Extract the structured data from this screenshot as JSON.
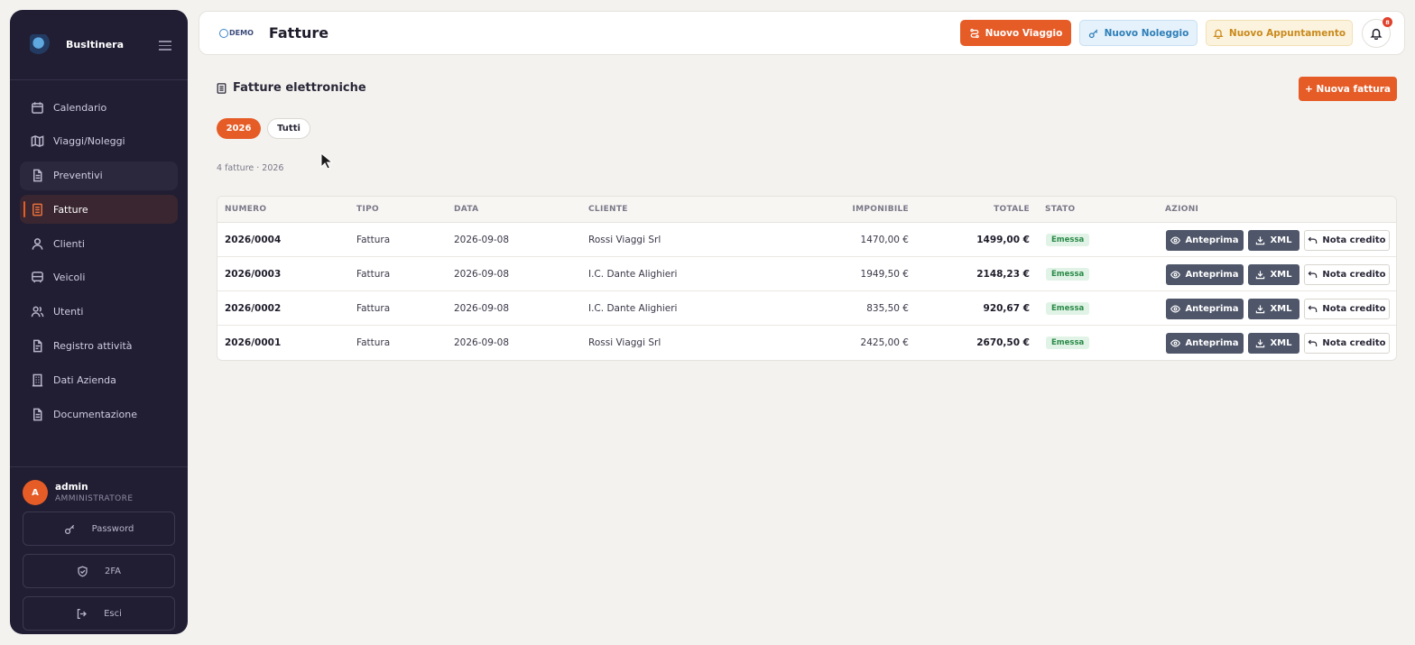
{
  "app": {
    "brand_name": "BusItinera",
    "page_title": "Fatture",
    "demo_label": "DEMO"
  },
  "sidebar": {
    "items": [
      {
        "label": "Calendario",
        "icon": "calendar-icon"
      },
      {
        "label": "Viaggi/Noleggi",
        "icon": "map-icon"
      },
      {
        "label": "Preventivi",
        "icon": "document-icon"
      },
      {
        "label": "Fatture",
        "icon": "invoice-icon"
      },
      {
        "label": "Clienti",
        "icon": "user-icon"
      },
      {
        "label": "Veicoli",
        "icon": "bus-icon"
      },
      {
        "label": "Utenti",
        "icon": "users-icon"
      },
      {
        "label": "Registro attività",
        "icon": "log-icon"
      },
      {
        "label": "Dati Azienda",
        "icon": "building-icon"
      },
      {
        "label": "Documentazione",
        "icon": "docs-icon"
      }
    ],
    "active_index": 3,
    "hover_index": 2,
    "user": {
      "initial": "A",
      "name": "admin",
      "role": "AMMINISTRATORE"
    },
    "password_label": "Password",
    "twofa_label": "2FA",
    "logout_label": "Esci"
  },
  "header": {
    "new_trip": "Nuovo Viaggio",
    "new_rental": "Nuovo Noleggio",
    "new_appointment": "Nuovo Appuntamento",
    "notification_count": "8"
  },
  "content": {
    "section_title": "Fatture elettroniche",
    "new_invoice": "+ Nuova fattura",
    "filters": [
      "2026",
      "Tutti"
    ],
    "selected_filter": "2026",
    "count_text": "4 fatture · 2026"
  },
  "table": {
    "columns": [
      "NUMERO",
      "TIPO",
      "DATA",
      "CLIENTE",
      "IMPONIBILE",
      "TOTALE",
      "STATO",
      "AZIONI"
    ],
    "rows": [
      {
        "numero": "2026/0004",
        "tipo": "Fattura",
        "data": "2026-09-08",
        "cliente": "Rossi Viaggi Srl",
        "imponibile": "1470,00 €",
        "totale": "1499,00 €",
        "stato": "Emessa"
      },
      {
        "numero": "2026/0003",
        "tipo": "Fattura",
        "data": "2026-09-08",
        "cliente": "I.C. Dante Alighieri",
        "imponibile": "1949,50 €",
        "totale": "2148,23 €",
        "stato": "Emessa"
      },
      {
        "numero": "2026/0002",
        "tipo": "Fattura",
        "data": "2026-09-08",
        "cliente": "I.C. Dante Alighieri",
        "imponibile": "835,50 €",
        "totale": "920,67 €",
        "stato": "Emessa"
      },
      {
        "numero": "2026/0001",
        "tipo": "Fattura",
        "data": "2026-09-08",
        "cliente": "Rossi Viaggi Srl",
        "imponibile": "2425,00 €",
        "totale": "2670,50 €",
        "stato": "Emessa"
      }
    ],
    "actions": {
      "preview": "Anteprima",
      "xml": "XML",
      "credit_note": "Nota credito"
    }
  },
  "colors": {
    "accent": "#e65c27",
    "sidebar_bg": "#211e33",
    "status_green": "#2a8a48"
  }
}
